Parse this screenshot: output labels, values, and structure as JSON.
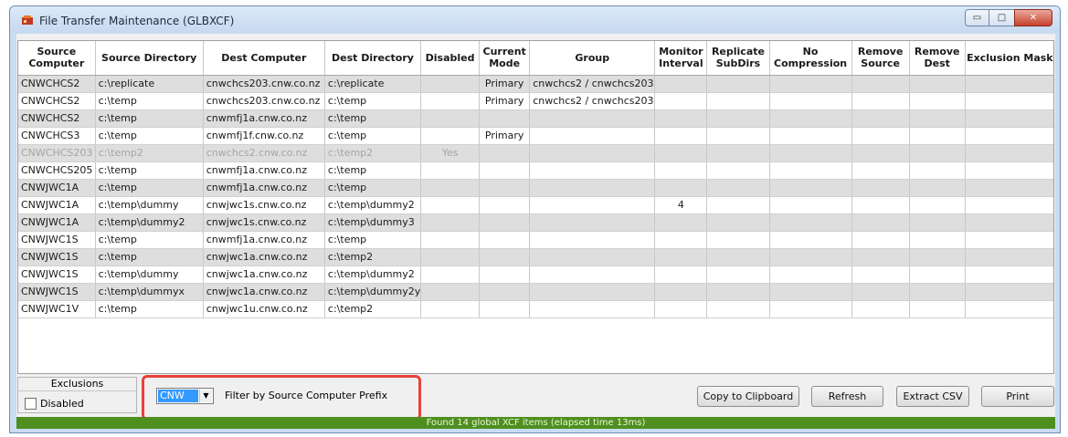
{
  "window": {
    "title": "File Transfer Maintenance (GLBXCF)",
    "minimize": "▭",
    "maximize": "□",
    "close": "✕"
  },
  "grid": {
    "columns": [
      {
        "l1": "Source",
        "l2": "Computer"
      },
      {
        "l1": "Source Directory",
        "l2": ""
      },
      {
        "l1": "Dest Computer",
        "l2": ""
      },
      {
        "l1": "Dest Directory",
        "l2": ""
      },
      {
        "l1": "Disabled",
        "l2": ""
      },
      {
        "l1": "Current",
        "l2": "Mode"
      },
      {
        "l1": "Group",
        "l2": ""
      },
      {
        "l1": "Monitor",
        "l2": "Interval"
      },
      {
        "l1": "Replicate",
        "l2": "SubDirs"
      },
      {
        "l1": "No",
        "l2": "Compression"
      },
      {
        "l1": "Remove",
        "l2": "Source"
      },
      {
        "l1": "Remove",
        "l2": "Dest"
      },
      {
        "l1": "Exclusion Mask",
        "l2": ""
      }
    ],
    "rows": [
      {
        "cells": [
          "CNWCHCS2",
          "c:\\replicate",
          "cnwchcs203.cnw.co.nz",
          "c:\\replicate",
          "",
          "Primary",
          "cnwchcs2 / cnwchcs203",
          "",
          "",
          "",
          "",
          "",
          ""
        ],
        "style": "grey"
      },
      {
        "cells": [
          "CNWCHCS2",
          "c:\\temp",
          "cnwchcs203.cnw.co.nz",
          "c:\\temp",
          "",
          "Primary",
          "cnwchcs2 / cnwchcs203",
          "",
          "",
          "",
          "",
          "",
          ""
        ],
        "style": "white"
      },
      {
        "cells": [
          "CNWCHCS2",
          "c:\\temp",
          "cnwmfj1a.cnw.co.nz",
          "c:\\temp",
          "",
          "",
          "",
          "",
          "",
          "",
          "",
          "",
          ""
        ],
        "style": "grey"
      },
      {
        "cells": [
          "CNWCHCS3",
          "c:\\temp",
          "cnwmfj1f.cnw.co.nz",
          "c:\\temp",
          "",
          "Primary",
          "",
          "",
          "",
          "",
          "",
          "",
          ""
        ],
        "style": "white"
      },
      {
        "cells": [
          "CNWCHCS203",
          "c:\\temp2",
          "cnwchcs2.cnw.co.nz",
          "c:\\temp2",
          "Yes",
          "",
          "",
          "",
          "",
          "",
          "",
          "",
          ""
        ],
        "style": "grey dim"
      },
      {
        "cells": [
          "CNWCHCS205",
          "c:\\temp",
          "cnwmfj1a.cnw.co.nz",
          "c:\\temp",
          "",
          "",
          "",
          "",
          "",
          "",
          "",
          "",
          ""
        ],
        "style": "white"
      },
      {
        "cells": [
          "CNWJWC1A",
          "c:\\temp",
          "cnwmfj1a.cnw.co.nz",
          "c:\\temp",
          "",
          "",
          "",
          "",
          "",
          "",
          "",
          "",
          ""
        ],
        "style": "grey"
      },
      {
        "cells": [
          "CNWJWC1A",
          "c:\\temp\\dummy",
          "cnwjwc1s.cnw.co.nz",
          "c:\\temp\\dummy2",
          "",
          "",
          "",
          "4",
          "",
          "",
          "",
          "",
          ""
        ],
        "style": "white"
      },
      {
        "cells": [
          "CNWJWC1A",
          "c:\\temp\\dummy2",
          "cnwjwc1s.cnw.co.nz",
          "c:\\temp\\dummy3",
          "",
          "",
          "",
          "",
          "",
          "",
          "",
          "",
          ""
        ],
        "style": "grey"
      },
      {
        "cells": [
          "CNWJWC1S",
          "c:\\temp",
          "cnwmfj1a.cnw.co.nz",
          "c:\\temp",
          "",
          "",
          "",
          "",
          "",
          "",
          "",
          "",
          ""
        ],
        "style": "white"
      },
      {
        "cells": [
          "CNWJWC1S",
          "c:\\temp",
          "cnwjwc1a.cnw.co.nz",
          "c:\\temp2",
          "",
          "",
          "",
          "",
          "",
          "",
          "",
          "",
          ""
        ],
        "style": "grey"
      },
      {
        "cells": [
          "CNWJWC1S",
          "c:\\temp\\dummy",
          "cnwjwc1a.cnw.co.nz",
          "c:\\temp\\dummy2",
          "",
          "",
          "",
          "",
          "",
          "",
          "",
          "",
          ""
        ],
        "style": "white"
      },
      {
        "cells": [
          "CNWJWC1S",
          "c:\\temp\\dummyx",
          "cnwjwc1a.cnw.co.nz",
          "c:\\temp\\dummy2y",
          "",
          "",
          "",
          "",
          "",
          "",
          "",
          "",
          ""
        ],
        "style": "grey"
      },
      {
        "cells": [
          "CNWJWC1V",
          "c:\\temp",
          "cnwjwc1u.cnw.co.nz",
          "c:\\temp2",
          "",
          "",
          "",
          "",
          "",
          "",
          "",
          "",
          ""
        ],
        "style": "white"
      }
    ]
  },
  "exclusions": {
    "title": "Exclusions",
    "disabled_label": "Disabled",
    "disabled_checked": false
  },
  "filter": {
    "value": "CNW",
    "label": "Filter by Source Computer Prefix"
  },
  "buttons": {
    "copy": "Copy to Clipboard",
    "refresh": "Refresh",
    "extract": "Extract CSV",
    "print": "Print"
  },
  "status": "Found  14  global XCF items  (elapsed time 13ms)",
  "colors": {
    "row_alt": "#dedede",
    "status_bar": "#4f8f1f",
    "highlight": "#e8413b",
    "selection": "#3399ff"
  }
}
